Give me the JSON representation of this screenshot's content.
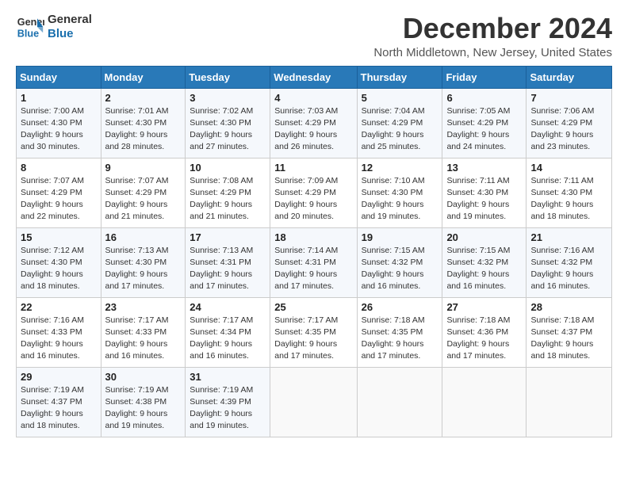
{
  "logo": {
    "line1": "General",
    "line2": "Blue"
  },
  "title": "December 2024",
  "subtitle": "North Middletown, New Jersey, United States",
  "days_of_week": [
    "Sunday",
    "Monday",
    "Tuesday",
    "Wednesday",
    "Thursday",
    "Friday",
    "Saturday"
  ],
  "weeks": [
    [
      {
        "day": "1",
        "rise": "7:00 AM",
        "set": "4:30 PM",
        "hours": "9 hours and 30 minutes."
      },
      {
        "day": "2",
        "rise": "7:01 AM",
        "set": "4:30 PM",
        "hours": "9 hours and 28 minutes."
      },
      {
        "day": "3",
        "rise": "7:02 AM",
        "set": "4:30 PM",
        "hours": "9 hours and 27 minutes."
      },
      {
        "day": "4",
        "rise": "7:03 AM",
        "set": "4:29 PM",
        "hours": "9 hours and 26 minutes."
      },
      {
        "day": "5",
        "rise": "7:04 AM",
        "set": "4:29 PM",
        "hours": "9 hours and 25 minutes."
      },
      {
        "day": "6",
        "rise": "7:05 AM",
        "set": "4:29 PM",
        "hours": "9 hours and 24 minutes."
      },
      {
        "day": "7",
        "rise": "7:06 AM",
        "set": "4:29 PM",
        "hours": "9 hours and 23 minutes."
      }
    ],
    [
      {
        "day": "8",
        "rise": "7:07 AM",
        "set": "4:29 PM",
        "hours": "9 hours and 22 minutes."
      },
      {
        "day": "9",
        "rise": "7:07 AM",
        "set": "4:29 PM",
        "hours": "9 hours and 21 minutes."
      },
      {
        "day": "10",
        "rise": "7:08 AM",
        "set": "4:29 PM",
        "hours": "9 hours and 21 minutes."
      },
      {
        "day": "11",
        "rise": "7:09 AM",
        "set": "4:29 PM",
        "hours": "9 hours and 20 minutes."
      },
      {
        "day": "12",
        "rise": "7:10 AM",
        "set": "4:30 PM",
        "hours": "9 hours and 19 minutes."
      },
      {
        "day": "13",
        "rise": "7:11 AM",
        "set": "4:30 PM",
        "hours": "9 hours and 19 minutes."
      },
      {
        "day": "14",
        "rise": "7:11 AM",
        "set": "4:30 PM",
        "hours": "9 hours and 18 minutes."
      }
    ],
    [
      {
        "day": "15",
        "rise": "7:12 AM",
        "set": "4:30 PM",
        "hours": "9 hours and 18 minutes."
      },
      {
        "day": "16",
        "rise": "7:13 AM",
        "set": "4:30 PM",
        "hours": "9 hours and 17 minutes."
      },
      {
        "day": "17",
        "rise": "7:13 AM",
        "set": "4:31 PM",
        "hours": "9 hours and 17 minutes."
      },
      {
        "day": "18",
        "rise": "7:14 AM",
        "set": "4:31 PM",
        "hours": "9 hours and 17 minutes."
      },
      {
        "day": "19",
        "rise": "7:15 AM",
        "set": "4:32 PM",
        "hours": "9 hours and 16 minutes."
      },
      {
        "day": "20",
        "rise": "7:15 AM",
        "set": "4:32 PM",
        "hours": "9 hours and 16 minutes."
      },
      {
        "day": "21",
        "rise": "7:16 AM",
        "set": "4:32 PM",
        "hours": "9 hours and 16 minutes."
      }
    ],
    [
      {
        "day": "22",
        "rise": "7:16 AM",
        "set": "4:33 PM",
        "hours": "9 hours and 16 minutes."
      },
      {
        "day": "23",
        "rise": "7:17 AM",
        "set": "4:33 PM",
        "hours": "9 hours and 16 minutes."
      },
      {
        "day": "24",
        "rise": "7:17 AM",
        "set": "4:34 PM",
        "hours": "9 hours and 16 minutes."
      },
      {
        "day": "25",
        "rise": "7:17 AM",
        "set": "4:35 PM",
        "hours": "9 hours and 17 minutes."
      },
      {
        "day": "26",
        "rise": "7:18 AM",
        "set": "4:35 PM",
        "hours": "9 hours and 17 minutes."
      },
      {
        "day": "27",
        "rise": "7:18 AM",
        "set": "4:36 PM",
        "hours": "9 hours and 17 minutes."
      },
      {
        "day": "28",
        "rise": "7:18 AM",
        "set": "4:37 PM",
        "hours": "9 hours and 18 minutes."
      }
    ],
    [
      {
        "day": "29",
        "rise": "7:19 AM",
        "set": "4:37 PM",
        "hours": "9 hours and 18 minutes."
      },
      {
        "day": "30",
        "rise": "7:19 AM",
        "set": "4:38 PM",
        "hours": "9 hours and 19 minutes."
      },
      {
        "day": "31",
        "rise": "7:19 AM",
        "set": "4:39 PM",
        "hours": "9 hours and 19 minutes."
      },
      null,
      null,
      null,
      null
    ]
  ],
  "labels": {
    "sunrise": "Sunrise:",
    "sunset": "Sunset:",
    "daylight": "Daylight:"
  }
}
